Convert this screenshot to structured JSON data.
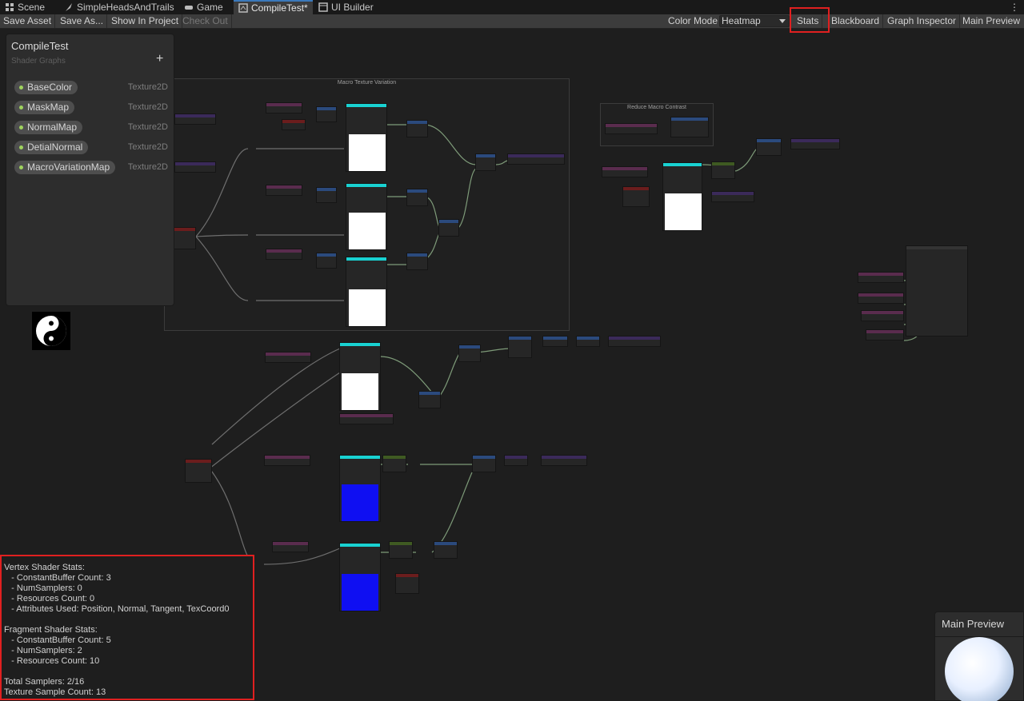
{
  "tabs": [
    {
      "label": "Scene",
      "icon": "scene-grid-icon",
      "active": false
    },
    {
      "label": "SimpleHeadsAndTrails",
      "icon": "shader-feather-icon",
      "active": false
    },
    {
      "label": "Game",
      "icon": "gamepad-icon",
      "active": false
    },
    {
      "label": "CompileTest*",
      "icon": "shader-graph-icon",
      "active": true
    },
    {
      "label": "UI Builder",
      "icon": "ui-builder-icon",
      "active": false
    }
  ],
  "toolbar": {
    "save_asset": "Save Asset",
    "save_as": "Save As...",
    "show_in_project": "Show In Project",
    "check_out": "Check Out",
    "color_mode_label": "Color Mode",
    "color_mode_value": "Heatmap",
    "stats": "Stats",
    "blackboard": "Blackboard",
    "graph_inspector": "Graph Inspector",
    "main_preview": "Main Preview"
  },
  "blackboard": {
    "title": "CompileTest",
    "subtitle": "Shader Graphs",
    "add_icon": "+",
    "properties": [
      {
        "name": "BaseColor",
        "type": "Texture2D"
      },
      {
        "name": "MaskMap",
        "type": "Texture2D"
      },
      {
        "name": "NormalMap",
        "type": "Texture2D"
      },
      {
        "name": "DetialNormal",
        "type": "Texture2D"
      },
      {
        "name": "MacroVariationMap",
        "type": "Texture2D"
      }
    ]
  },
  "graph": {
    "groups": [
      {
        "title": "Macro Texture Variation"
      },
      {
        "title": "Reduce Macro Contrast"
      }
    ]
  },
  "stats": {
    "lines": [
      "Vertex Shader Stats:",
      "   - ConstantBuffer Count: 3",
      "   - NumSamplers: 0",
      "   - Resources Count: 0",
      "   - Attributes Used: Position, Normal, Tangent, TexCoord0",
      "",
      "Fragment Shader Stats:",
      "   - ConstantBuffer Count: 5",
      "   - NumSamplers: 2",
      "   - Resources Count: 10",
      "",
      "Total Samplers: 2/16",
      "Texture Sample Count: 13"
    ]
  },
  "main_preview": {
    "title": "Main Preview"
  },
  "colors": {
    "highlight": "#e02020",
    "property_dot": "#9fd35e",
    "node_header_texture": "#19d2d2",
    "preview_blue": "#0f0ff2"
  }
}
